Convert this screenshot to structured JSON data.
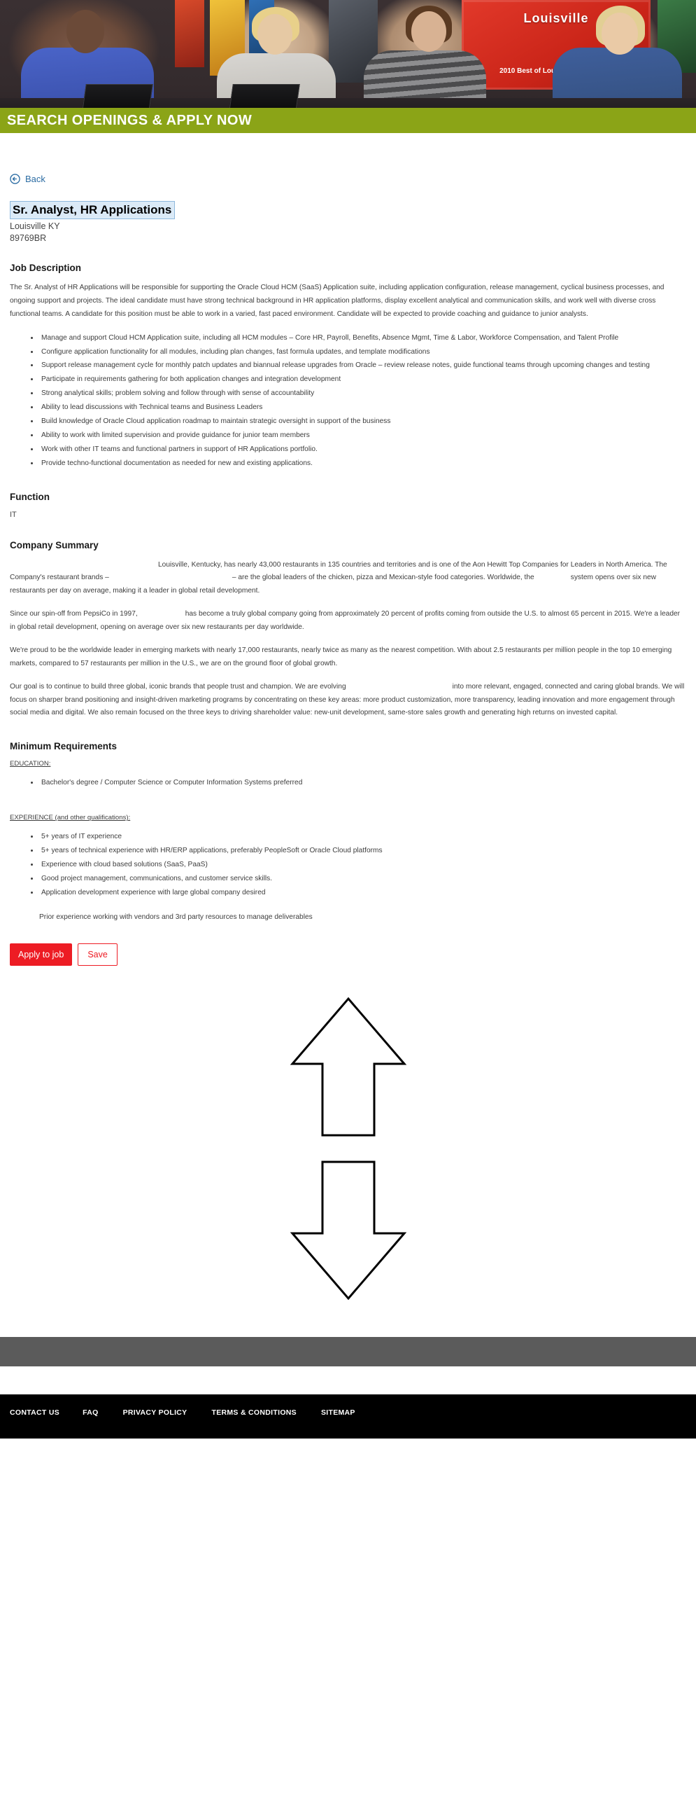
{
  "hero": {
    "banner_text": "SEARCH OPENINGS & APPLY NOW",
    "poster_title": "Louisville",
    "poster_subtitle": "2010 Best of Louisville Employers"
  },
  "nav": {
    "back_label": "Back",
    "back_icon": "circle-arrow-left-icon"
  },
  "job": {
    "title": "Sr. Analyst, HR Applications",
    "location": "Louisville KY",
    "req_id": "89769BR"
  },
  "job_description": {
    "heading": "Job Description",
    "intro": "The Sr. Analyst of HR Applications will be responsible for supporting the Oracle Cloud HCM (SaaS) Application suite, including application configuration, release management, cyclical business processes, and ongoing support and projects.  The ideal candidate must have strong technical background in HR application platforms, display excellent analytical and communication skills, and work well with diverse cross functional teams. A candidate for this position must be able to work in a varied, fast paced environment. Candidate will be expected to provide coaching and guidance to junior analysts.",
    "bullets": [
      "Manage and support Cloud HCM Application suite, including all HCM modules – Core HR, Payroll, Benefits, Absence Mgmt, Time & Labor, Workforce Compensation, and Talent Profile",
      "Configure application functionality for all modules, including plan changes, fast formula updates, and template modifications",
      "Support release management cycle for monthly patch updates and biannual release upgrades from Oracle – review release notes, guide functional teams through upcoming changes and testing",
      "Participate in requirements gathering for both application changes and integration development",
      "Strong analytical skills; problem solving and follow through with sense of accountability",
      "Ability to lead discussions with Technical teams and Business Leaders",
      "Build knowledge of Oracle Cloud application roadmap to maintain strategic oversight in support of the business",
      "Ability to work with limited supervision and provide guidance for junior team members",
      "Work with other IT teams and functional partners in support of HR Applications portfolio.",
      "Provide techno-functional documentation as needed for new and existing applications."
    ]
  },
  "function": {
    "heading": "Function",
    "value": "IT"
  },
  "company_summary": {
    "heading": "Company Summary",
    "p1_a": "",
    "p1_b": "Louisville, Kentucky, has nearly 43,000 restaurants in 135 countries and territories and is one of the Aon Hewitt Top Companies for Leaders in North America. The Company's restaurant brands –",
    "p1_c": "",
    "p1_d": "– are the global leaders of the chicken, pizza and Mexican-style food categories. Worldwide, the",
    "p1_e": "",
    "p1_f": "system opens over six new restaurants per day on average, making it a leader in global retail development.",
    "p2_a": "Since our spin-off from PepsiCo in 1997,",
    "p2_b": "",
    "p2_c": "has become a truly global company going from approximately 20 percent of profits coming from outside the U.S. to almost 65 percent in 2015. We're a leader in global retail development, opening on average over six new restaurants per day worldwide.",
    "p3": "We're proud to be the worldwide leader in emerging markets with nearly 17,000 restaurants, nearly twice as many as the nearest competition. With about 2.5 restaurants per million people in the top 10 emerging markets, compared to 57 restaurants per million in the U.S., we are on the ground floor of global growth.",
    "p4_a": "Our goal is to continue to build three global, iconic brands that people trust and champion. We are evolving",
    "p4_b": "",
    "p4_c": "into more relevant, engaged, connected and caring global brands. We will focus on sharper brand positioning and insight-driven marketing programs by concentrating on these key areas: more product customization, more transparency, leading innovation and more engagement through social media and digital. We also remain focused on the three keys to driving shareholder value: new-unit development, same-store sales growth and generating high returns on invested capital."
  },
  "minimum_requirements": {
    "heading": "Minimum Requirements",
    "education_label": "EDUCATION:",
    "education_bullets": [
      "Bachelor's degree / Computer Science or Computer Information Systems preferred"
    ],
    "experience_label": "EXPERIENCE (and other qualifications):",
    "experience_bullets": [
      "5+ years of IT experience",
      "5+ years of technical experience with HR/ERP applications, preferably PeopleSoft or Oracle Cloud platforms",
      "Experience with cloud based solutions (SaaS, PaaS)",
      "Good project management, communications, and customer service skills.",
      "Application development experience with large global company desired"
    ],
    "closing_note": "Prior experience working with vendors and 3rd party resources to manage deliverables"
  },
  "actions": {
    "apply_label": "Apply to job",
    "save_label": "Save"
  },
  "decor": {
    "arrow_up": "arrow-up-outline",
    "arrow_down": "arrow-down-outline"
  },
  "footer": {
    "links": [
      "CONTACT US",
      "FAQ",
      "PRIVACY POLICY",
      "TERMS & CONDITIONS",
      "SITEMAP"
    ]
  },
  "colors": {
    "banner_green": "#8ba417",
    "accent_red": "#ed1c24",
    "link_blue": "#2b6ca3",
    "title_highlight": "#dbeaf7",
    "footer_black": "#000000",
    "gray_bar": "#5b5b5b"
  }
}
